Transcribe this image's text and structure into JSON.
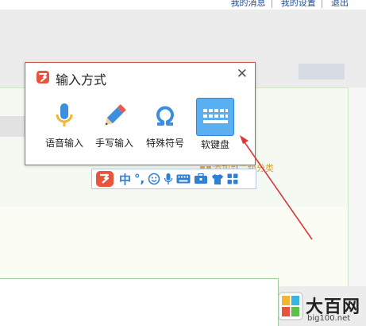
{
  "top_links": [
    "我的消息",
    "我的设置",
    "退出"
  ],
  "colors": {
    "accent": "#2f7fd6",
    "brand": "#e8553d",
    "selected": "#5aaef2",
    "arrow": "#d9373b"
  },
  "popup": {
    "title": "输入方式",
    "close_icon": "close-icon",
    "tools": [
      {
        "label": "语音输入",
        "icon": "microphone-icon",
        "selected": false
      },
      {
        "label": "手写输入",
        "icon": "pencil-icon",
        "selected": false
      },
      {
        "label": "特殊符号",
        "icon": "omega-icon",
        "selected": false
      },
      {
        "label": "软键盘",
        "icon": "keyboard-icon",
        "selected": true
      }
    ]
  },
  "statusbar": {
    "mode": "中",
    "punct": "°,",
    "icons": [
      "emoji-icon",
      "microphone-icon",
      "keyboard-icon",
      "toolbox-icon",
      "shirt-icon",
      "grid-icon"
    ]
  },
  "category_text": "添加到二级分类",
  "watermark": {
    "text": "大百网",
    "url": "big100.net"
  }
}
